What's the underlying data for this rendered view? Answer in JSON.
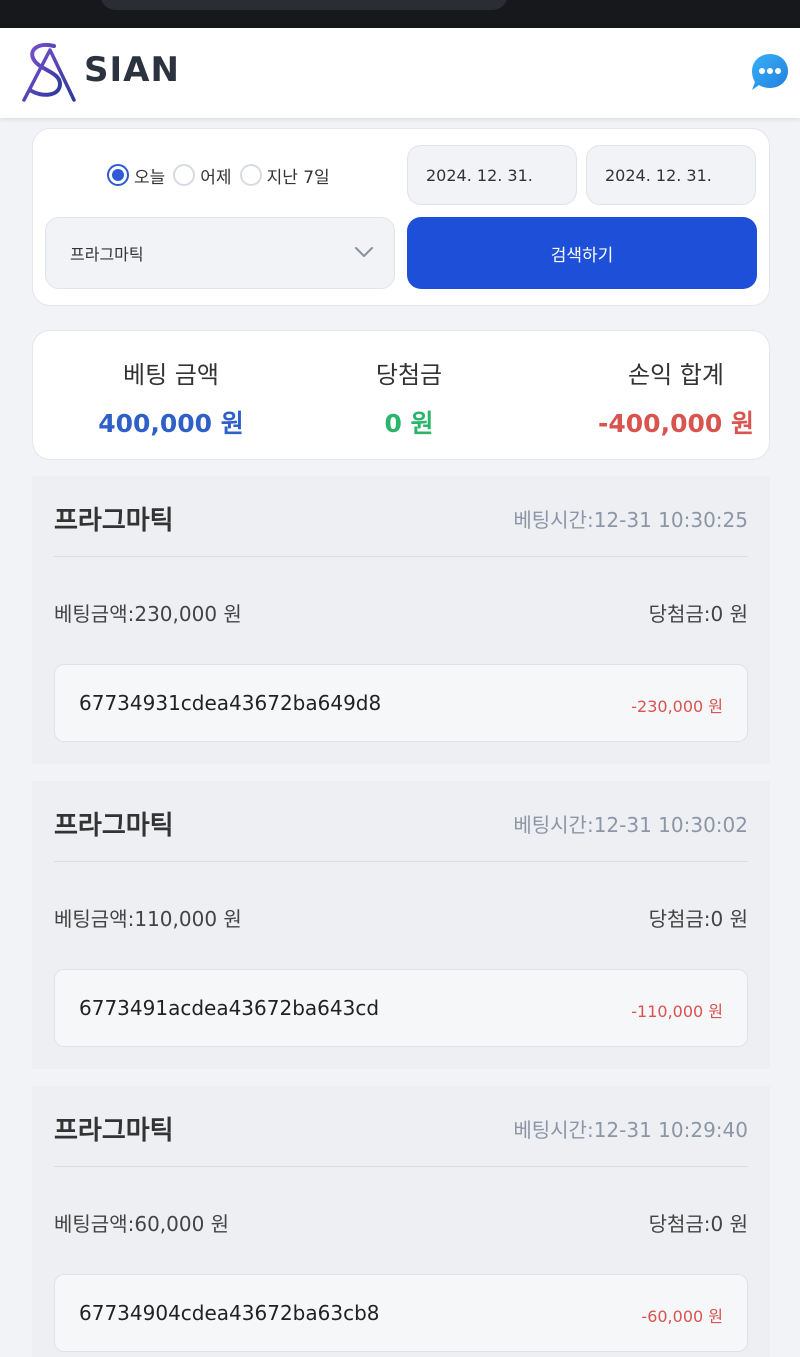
{
  "header": {
    "logo_text": "SIAN",
    "chat_icon": "chat-bubble-icon"
  },
  "filter": {
    "radios": [
      {
        "label": "오늘",
        "checked": true
      },
      {
        "label": "어제",
        "checked": false
      },
      {
        "label": "지난 7일",
        "checked": false
      }
    ],
    "date_from": "2024. 12. 31.",
    "date_to": "2024. 12. 31.",
    "game_select": "프라그마틱",
    "search_label": "검색하기"
  },
  "summary": {
    "bet_label": "베팅 금액",
    "bet_value": "400,000 원",
    "win_label": "당첨금",
    "win_value": "0 원",
    "pl_label": "손익 합계",
    "pl_value": "-400,000 원"
  },
  "bets": [
    {
      "title": "프라그마틱",
      "time": "베팅시간:12-31 10:30:25",
      "amount": "베팅금액:230,000 원",
      "win": "당첨금:0 원",
      "id": "67734931cdea43672ba649d8",
      "result": "-230,000 원"
    },
    {
      "title": "프라그마틱",
      "time": "베팅시간:12-31 10:30:02",
      "amount": "베팅금액:110,000 원",
      "win": "당첨금:0 원",
      "id": "6773491acdea43672ba643cd",
      "result": "-110,000 원"
    },
    {
      "title": "프라그마틱",
      "time": "베팅시간:12-31 10:29:40",
      "amount": "베팅금액:60,000 원",
      "win": "당첨금:0 원",
      "id": "67734904cdea43672ba63cb8",
      "result": "-60,000 원"
    }
  ],
  "colors": {
    "accent": "#1e4fd8",
    "positive": "#2bb56b",
    "negative": "#d9534f"
  }
}
